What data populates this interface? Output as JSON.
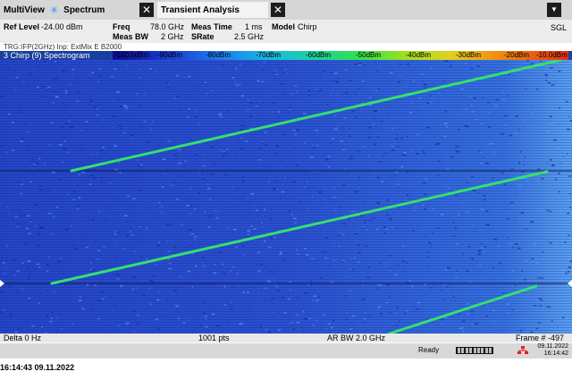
{
  "tabs": {
    "multiview": "MultiView",
    "star": "✳",
    "spectrum": "Spectrum",
    "transient": "Transient Analysis",
    "close": "✕",
    "dropdown": "▼"
  },
  "settings": {
    "ref_level_label": "Ref Level",
    "ref_level": "-24.00 dBm",
    "freq_label": "Freq",
    "freq": "78.0 GHz",
    "meas_bw_label": "Meas BW",
    "meas_bw": "2 GHz",
    "meas_time_label": "Meas Time",
    "meas_time": "1 ms",
    "srate_label": "SRate",
    "srate": "2.5 GHz",
    "model_label": "Model",
    "model": "Chirp",
    "mode": "SGL"
  },
  "trigger_line": "TRG:IFP(2GHz) Inp: ExtMix E B2000",
  "spectrogram": {
    "title": "3 Chirp (9) Spectrogram",
    "colorbar_ticks": [
      "-100.0dBm",
      "-90dBm",
      "-80dBm",
      "-70dBm",
      "-60dBm",
      "-50dBm",
      "-40dBm",
      "-30dBm",
      "-20dBm",
      "-10.0dBm"
    ],
    "colorbar_colors": [
      "#0b0b8a",
      "#1e7ef0",
      "#1fd0a0",
      "#30e050",
      "#e0d020",
      "#e03010"
    ],
    "trace_color": "#34e070"
  },
  "footer": {
    "delta": "Delta 0 Hz",
    "pts": "1001 pts",
    "ar_bw": "AR BW 2.0 GHz",
    "frame": "Frame # -497"
  },
  "status": {
    "ready": "Ready",
    "date": "09.11.2022",
    "time": "16:14:42"
  },
  "bottom_timestamp": "16:14:43  09.11.2022"
}
